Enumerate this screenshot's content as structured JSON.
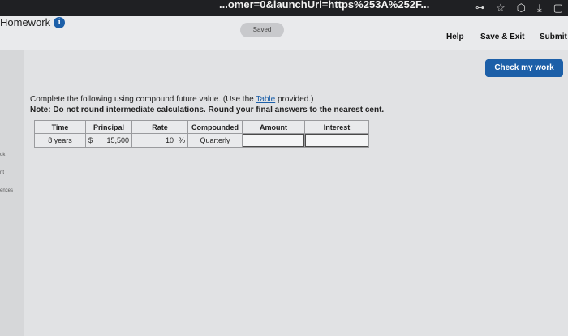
{
  "browser": {
    "url": "...omer=0&launchUrl=https%253A%252F...",
    "icons": [
      "key-icon",
      "star-icon",
      "extension-icon",
      "download-icon",
      "window-icon"
    ]
  },
  "header": {
    "title": "Homework",
    "saved_label": "Saved",
    "help_label": "Help",
    "save_exit_label": "Save & Exit",
    "submit_label": "Submit"
  },
  "left_strip": {
    "labels": [
      "ok",
      "nt",
      "ences"
    ]
  },
  "main": {
    "check_button_label": "Check my work",
    "instruction_prefix": "Complete the following using compound future value. (Use the ",
    "instruction_link": "Table",
    "instruction_suffix": " provided.)",
    "note": "Note: Do not round intermediate calculations. Round your final answers to the nearest cent."
  },
  "table": {
    "headers": [
      "Time",
      "Principal",
      "Rate",
      "Compounded",
      "Amount",
      "Interest"
    ],
    "row": {
      "time": "8 years",
      "principal_currency": "$",
      "principal_value": "15,500",
      "rate_value": "10",
      "rate_unit": "%",
      "compounded": "Quarterly",
      "amount": "",
      "interest": ""
    }
  }
}
